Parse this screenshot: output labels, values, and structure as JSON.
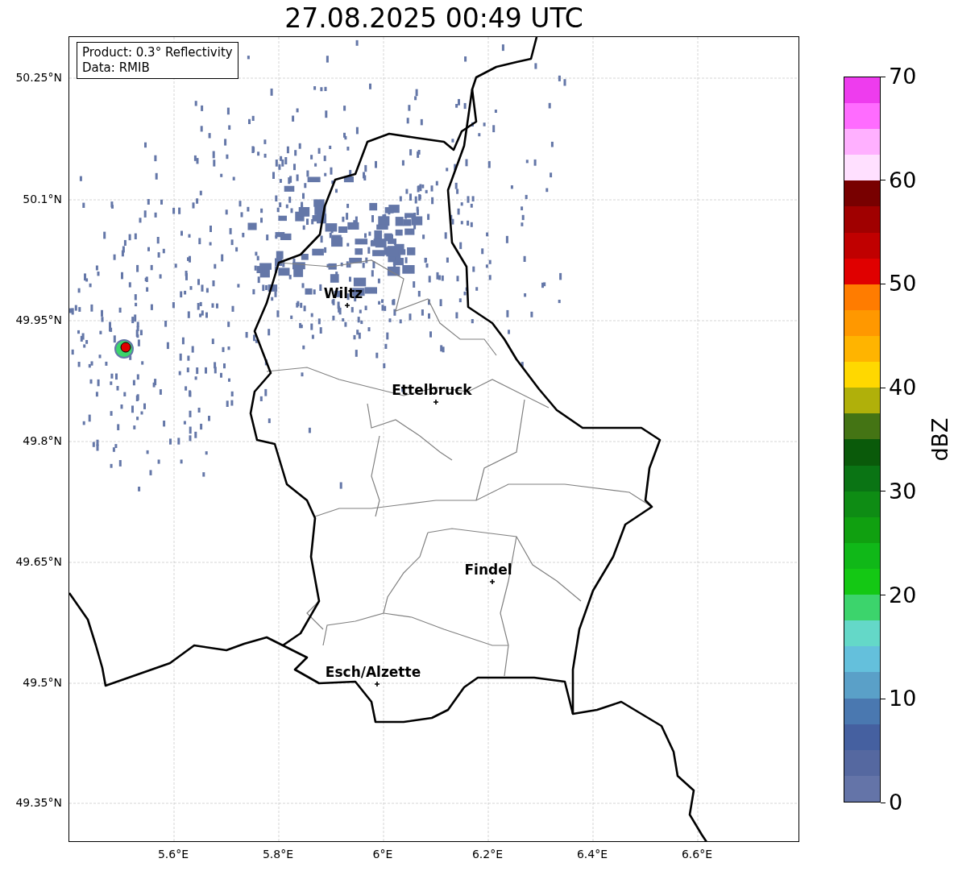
{
  "title": "27.08.2025 00:49 UTC",
  "info_box": {
    "lines": [
      "Product: 0.3° Reflectivity",
      "Data: RMIB"
    ]
  },
  "map": {
    "lat_labels": [
      "50.25°N",
      "50.1°N",
      "49.95°N",
      "49.8°N",
      "49.65°N",
      "49.5°N",
      "49.35°N"
    ],
    "lon_labels": [
      "5.6°E",
      "5.8°E",
      "6°E",
      "6.2°E",
      "6.4°E",
      "6.6°E"
    ],
    "cities": [
      {
        "name": "Wiltz"
      },
      {
        "name": "Ettelbruck"
      },
      {
        "name": "Findel"
      },
      {
        "name": "Esch/Alzette"
      }
    ]
  },
  "colorbar": {
    "label": "dBZ",
    "ticks": [
      "70",
      "60",
      "50",
      "40",
      "30",
      "20",
      "10",
      "0"
    ],
    "segments": [
      {
        "color": "#6474a8"
      },
      {
        "color": "#5568a0"
      },
      {
        "color": "#4560a0"
      },
      {
        "color": "#4a78b0"
      },
      {
        "color": "#5aa0c8"
      },
      {
        "color": "#64c0dc"
      },
      {
        "color": "#64d8c8"
      },
      {
        "color": "#3cd46c"
      },
      {
        "color": "#14c814"
      },
      {
        "color": "#10b818"
      },
      {
        "color": "#10a010"
      },
      {
        "color": "#0e8c14"
      },
      {
        "color": "#0a7414"
      },
      {
        "color": "#0a5a0a"
      },
      {
        "color": "#447414"
      },
      {
        "color": "#b0b00a"
      },
      {
        "color": "#ffd800"
      },
      {
        "color": "#ffb400"
      },
      {
        "color": "#ff9800"
      },
      {
        "color": "#ff7c00"
      },
      {
        "color": "#e00000"
      },
      {
        "color": "#c00000"
      },
      {
        "color": "#a00000"
      },
      {
        "color": "#780000"
      },
      {
        "color": "#ffe0ff"
      },
      {
        "color": "#ffb0ff"
      },
      {
        "color": "#ff6cff"
      },
      {
        "color": "#ee3cee"
      }
    ]
  }
}
